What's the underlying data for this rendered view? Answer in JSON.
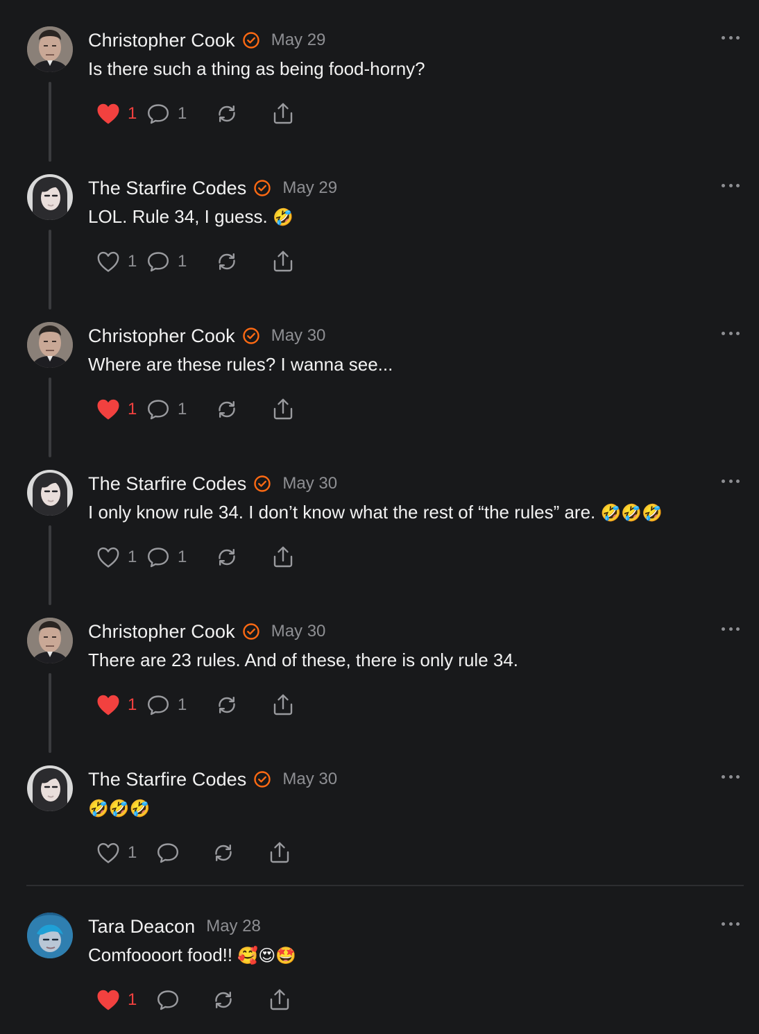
{
  "colors": {
    "background": "#18191b",
    "like_red": "#f2413f",
    "verified_orange": "#ff6a13",
    "muted": "#8e8f93"
  },
  "posts": [
    {
      "author": "Christopher Cook",
      "verified": true,
      "date": "May 29",
      "text": "Is there such a thing as being food-horny?",
      "emoji": "",
      "liked": true,
      "likes": "1",
      "replies": "1",
      "avatar": "man"
    },
    {
      "author": "The Starfire Codes",
      "verified": true,
      "date": "May 29",
      "text": "LOL. Rule 34, I guess. ",
      "emoji": "🤣",
      "liked": false,
      "likes": "1",
      "replies": "1",
      "avatar": "woman"
    },
    {
      "author": "Christopher Cook",
      "verified": true,
      "date": "May 30",
      "text": "Where are these rules? I wanna see...",
      "emoji": "",
      "liked": true,
      "likes": "1",
      "replies": "1",
      "avatar": "man"
    },
    {
      "author": "The Starfire Codes",
      "verified": true,
      "date": "May 30",
      "text": "I only know rule 34. I don’t know what the rest of “the rules” are. ",
      "emoji": "🤣🤣🤣",
      "liked": false,
      "likes": "1",
      "replies": "1",
      "avatar": "woman"
    },
    {
      "author": "Christopher Cook",
      "verified": true,
      "date": "May 30",
      "text": "There are 23 rules. And of these, there is only rule 34.",
      "emoji": "",
      "liked": true,
      "likes": "1",
      "replies": "1",
      "avatar": "man"
    },
    {
      "author": "The Starfire Codes",
      "verified": true,
      "date": "May 30",
      "text": "",
      "emoji": "🤣🤣🤣",
      "liked": false,
      "likes": "1",
      "replies": "",
      "avatar": "woman"
    },
    {
      "author": "Tara Deacon",
      "verified": false,
      "date": "May 28",
      "text": "Comfoooort food!! ",
      "emoji": "🥰😍🤩",
      "liked": true,
      "likes": "1",
      "replies": "",
      "avatar": "blue"
    }
  ]
}
